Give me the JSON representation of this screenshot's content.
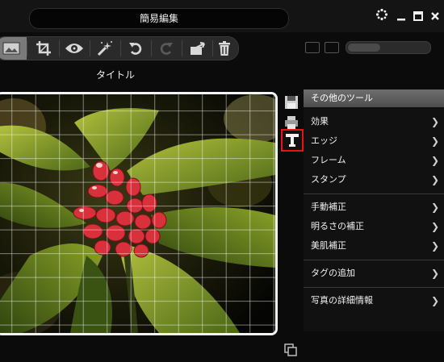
{
  "window": {
    "title": "簡易編集",
    "controls": [
      "settings-icon",
      "minimize-icon",
      "maximize-icon",
      "close-icon"
    ]
  },
  "toolbar": {
    "buttons": [
      "image-view-icon",
      "crop-icon",
      "red-eye-icon",
      "auto-fix-icon",
      "rotate-left-icon",
      "rotate-right-icon",
      "export-icon",
      "delete-icon"
    ]
  },
  "photo": {
    "title": "タイトル"
  },
  "side_tools": [
    "save-as-icon",
    "print-icon",
    "more-tools-icon"
  ],
  "tools_panel": {
    "header": "その他のツール",
    "groups": [
      [
        "効果",
        "エッジ",
        "フレーム",
        "スタンプ"
      ],
      [
        "手動補正",
        "明るさの補正",
        "美肌補正"
      ],
      [
        "タグの追加"
      ],
      [
        "写真の詳細情報"
      ]
    ]
  },
  "colors": {
    "background": "#0b0b0b",
    "panel_header": "#5e5e5e",
    "highlight_border": "#ee1111"
  }
}
